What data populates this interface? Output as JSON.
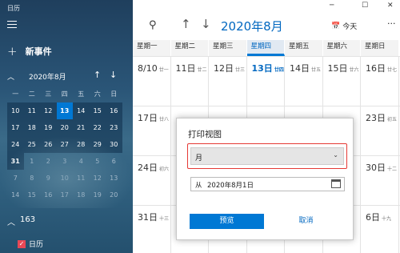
{
  "app": {
    "title": "日历"
  },
  "sidebar": {
    "new_event_label": "新事件",
    "mini_month": "2020年8月",
    "weekdays": [
      "一",
      "二",
      "三",
      "四",
      "五",
      "六",
      "日"
    ],
    "rows": [
      [
        "10",
        "11",
        "12",
        "13",
        "14",
        "15",
        "16"
      ],
      [
        "17",
        "18",
        "19",
        "20",
        "21",
        "22",
        "23"
      ],
      [
        "24",
        "25",
        "26",
        "27",
        "28",
        "29",
        "30"
      ],
      [
        "31",
        "1",
        "2",
        "3",
        "4",
        "5",
        "6"
      ],
      [
        "7",
        "8",
        "9",
        "10",
        "11",
        "12",
        "13"
      ],
      [
        "14",
        "15",
        "16",
        "17",
        "18",
        "19",
        "20"
      ]
    ],
    "accounts_count": "163",
    "calendar_item": "日历"
  },
  "toolbar": {
    "month_title": "2020年8月",
    "today_label": "今天",
    "more_label": "···"
  },
  "window": {
    "min": "─",
    "max": "☐",
    "close": "✕"
  },
  "weekday_headers": [
    "星期一",
    "星期二",
    "星期三",
    "星期四",
    "星期五",
    "星期六",
    "星期日"
  ],
  "weeks": [
    [
      {
        "n": "8/10",
        "l": "廿一"
      },
      {
        "n": "11日",
        "l": "廿二"
      },
      {
        "n": "12日",
        "l": "廿三"
      },
      {
        "n": "13日",
        "l": "廿四",
        "today": true
      },
      {
        "n": "14日",
        "l": "廿五"
      },
      {
        "n": "15日",
        "l": "廿六"
      },
      {
        "n": "16日",
        "l": "廿七"
      }
    ],
    [
      {
        "n": "17日",
        "l": "廿八"
      },
      {
        "n": "",
        "l": ""
      },
      {
        "n": "",
        "l": ""
      },
      {
        "n": "",
        "l": ""
      },
      {
        "n": "",
        "l": ""
      },
      {
        "n": "",
        "l": ""
      },
      {
        "n": "23日",
        "l": "初五"
      }
    ],
    [
      {
        "n": "24日",
        "l": "初六"
      },
      {
        "n": "",
        "l": ""
      },
      {
        "n": "",
        "l": ""
      },
      {
        "n": "",
        "l": ""
      },
      {
        "n": "",
        "l": ""
      },
      {
        "n": "",
        "l": ""
      },
      {
        "n": "30日",
        "l": "十二"
      }
    ],
    [
      {
        "n": "31日",
        "l": "十三"
      },
      {
        "n": "",
        "l": ""
      },
      {
        "n": "",
        "l": ""
      },
      {
        "n": "",
        "l": ""
      },
      {
        "n": "",
        "l": ""
      },
      {
        "n": "",
        "l": ""
      },
      {
        "n": "6日",
        "l": "十九"
      }
    ]
  ],
  "dialog": {
    "title": "打印视图",
    "view_value": "月",
    "from_label": "从",
    "from_value": "2020年8月1日",
    "preview_label": "预览",
    "cancel_label": "取消"
  },
  "colors": {
    "accent": "#0078d4",
    "highlight_border": "#e53935"
  }
}
